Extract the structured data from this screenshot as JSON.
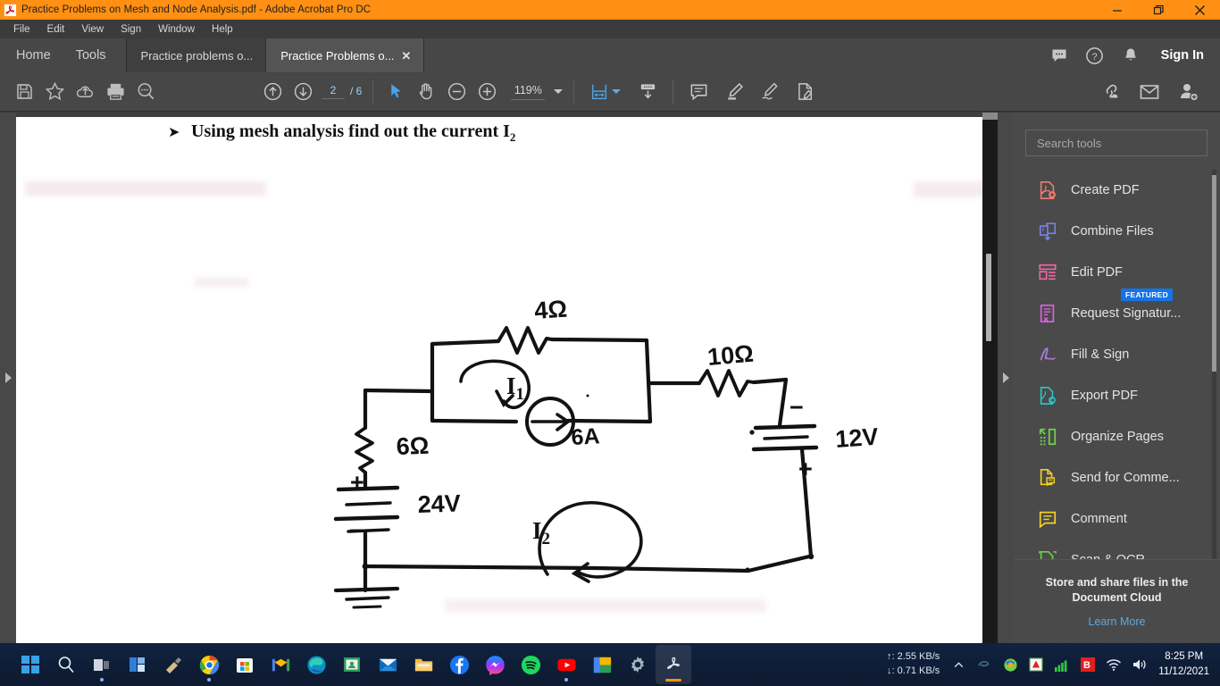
{
  "window": {
    "title": "Practice Problems on Mesh and  Node Analysis.pdf - Adobe Acrobat Pro DC",
    "app_icon": "acrobat-icon",
    "accent_color": "#ff9013",
    "minimize": "—",
    "restore": "❐",
    "close": "✕"
  },
  "menubar": {
    "items": [
      {
        "label": "File"
      },
      {
        "label": "Edit"
      },
      {
        "label": "View"
      },
      {
        "label": "Sign"
      },
      {
        "label": "Window"
      },
      {
        "label": "Help"
      }
    ]
  },
  "tabs": {
    "home": "Home",
    "tools": "Tools",
    "documents": [
      {
        "label": "Practice problems o...",
        "active": false
      },
      {
        "label": "Practice Problems o...",
        "active": true,
        "close": "✕"
      }
    ],
    "right_icons": [
      "comment-bubble-icon",
      "help-circle-icon",
      "bell-icon"
    ],
    "sign_in": "Sign In"
  },
  "toolbar": {
    "left_icons": [
      "save-icon",
      "star-icon",
      "upload-cloud-icon",
      "print-icon",
      "search-icon"
    ],
    "page_prev": "previous-page-icon",
    "page_next": "next-page-icon",
    "page_current": "2",
    "page_total": "/ 6",
    "select_tool": "select-cursor-icon",
    "hand_tool": "hand-icon",
    "zoom_out": "zoom-out-icon",
    "zoom_in": "zoom-in-icon",
    "zoom_value": "119%",
    "fit_page": "fit-page-icon",
    "scroll_mode": "scroll-mode-icon",
    "comment": "comment-icon",
    "highlight": "highlight-pen-icon",
    "draw": "draw-icon",
    "stamp": "stamp-icon",
    "right_icons": [
      "share-link-icon",
      "email-icon",
      "add-person-icon"
    ]
  },
  "document": {
    "heading_bullet": "➤",
    "heading_main": "Using mesh analysis find out the current I",
    "heading_sub": "2",
    "circuit": {
      "labels": {
        "r_top": "4Ω",
        "r_right": "10Ω",
        "r_left": "6Ω",
        "src_current": "6A",
        "src_left": "24V",
        "src_right": "12V",
        "mesh1": "I",
        "mesh1_sub": "1",
        "mesh2": "I",
        "mesh2_sub": "2",
        "plus_left": "+",
        "minus_left": "−",
        "minus_right": "−",
        "plus_right": "+"
      }
    }
  },
  "tools_panel": {
    "search_placeholder": "Search tools",
    "items": [
      {
        "label": "Create PDF",
        "icon": "create-pdf-icon",
        "color": "#f07d6e",
        "badge": null
      },
      {
        "label": "Combine Files",
        "icon": "combine-files-icon",
        "color": "#7b83e8",
        "badge": null
      },
      {
        "label": "Edit PDF",
        "icon": "edit-pdf-icon",
        "color": "#f264a6",
        "badge": null
      },
      {
        "label": "Request Signatur...",
        "icon": "request-signature-icon",
        "color": "#e061e0",
        "badge": "FEATURED"
      },
      {
        "label": "Fill & Sign",
        "icon": "fill-sign-icon",
        "color": "#b07ae8",
        "badge": null
      },
      {
        "label": "Export PDF",
        "icon": "export-pdf-icon",
        "color": "#2cc6c6",
        "badge": null
      },
      {
        "label": "Organize Pages",
        "icon": "organize-pages-icon",
        "color": "#6fd04a",
        "badge": null
      },
      {
        "label": "Send for Comme...",
        "icon": "send-for-comments-icon",
        "color": "#f2d024",
        "badge": null
      },
      {
        "label": "Comment",
        "icon": "comment-tool-icon",
        "color": "#f2d024",
        "badge": null
      },
      {
        "label": "Scan & OCR",
        "icon": "scan-ocr-icon",
        "color": "#6fd04a",
        "badge": null
      }
    ],
    "footer_title": "Store and share files in the Document Cloud",
    "footer_link": "Learn More",
    "badge_color": "#1473e6"
  },
  "taskbar": {
    "apps": [
      {
        "name": "start-windows-icon"
      },
      {
        "name": "search-icon"
      },
      {
        "name": "task-view-icon"
      },
      {
        "name": "widgets-icon"
      },
      {
        "name": "snipping-tool-icon"
      },
      {
        "name": "chrome-icon"
      },
      {
        "name": "microsoft-store-icon"
      },
      {
        "name": "gmail-icon"
      },
      {
        "name": "edge-icon"
      },
      {
        "name": "google-classroom-icon"
      },
      {
        "name": "mail-icon"
      },
      {
        "name": "file-explorer-icon"
      },
      {
        "name": "facebook-icon"
      },
      {
        "name": "messenger-icon"
      },
      {
        "name": "spotify-icon"
      },
      {
        "name": "youtube-icon"
      },
      {
        "name": "google-drive-icon"
      },
      {
        "name": "settings-icon"
      },
      {
        "name": "acrobat-icon"
      }
    ],
    "net_up": "↑: 2.55 KB/s",
    "net_down": "↓: 0.71 KB/s",
    "tray_icons": [
      "show-hidden-icons-chevron",
      "nvidia-icon",
      "idm-icon",
      "antivirus-icon",
      "network-signal-icon",
      "bitdefender-icon",
      "wifi-icon",
      "volume-icon"
    ],
    "time": "8:25 PM",
    "date": "11/12/2021"
  }
}
